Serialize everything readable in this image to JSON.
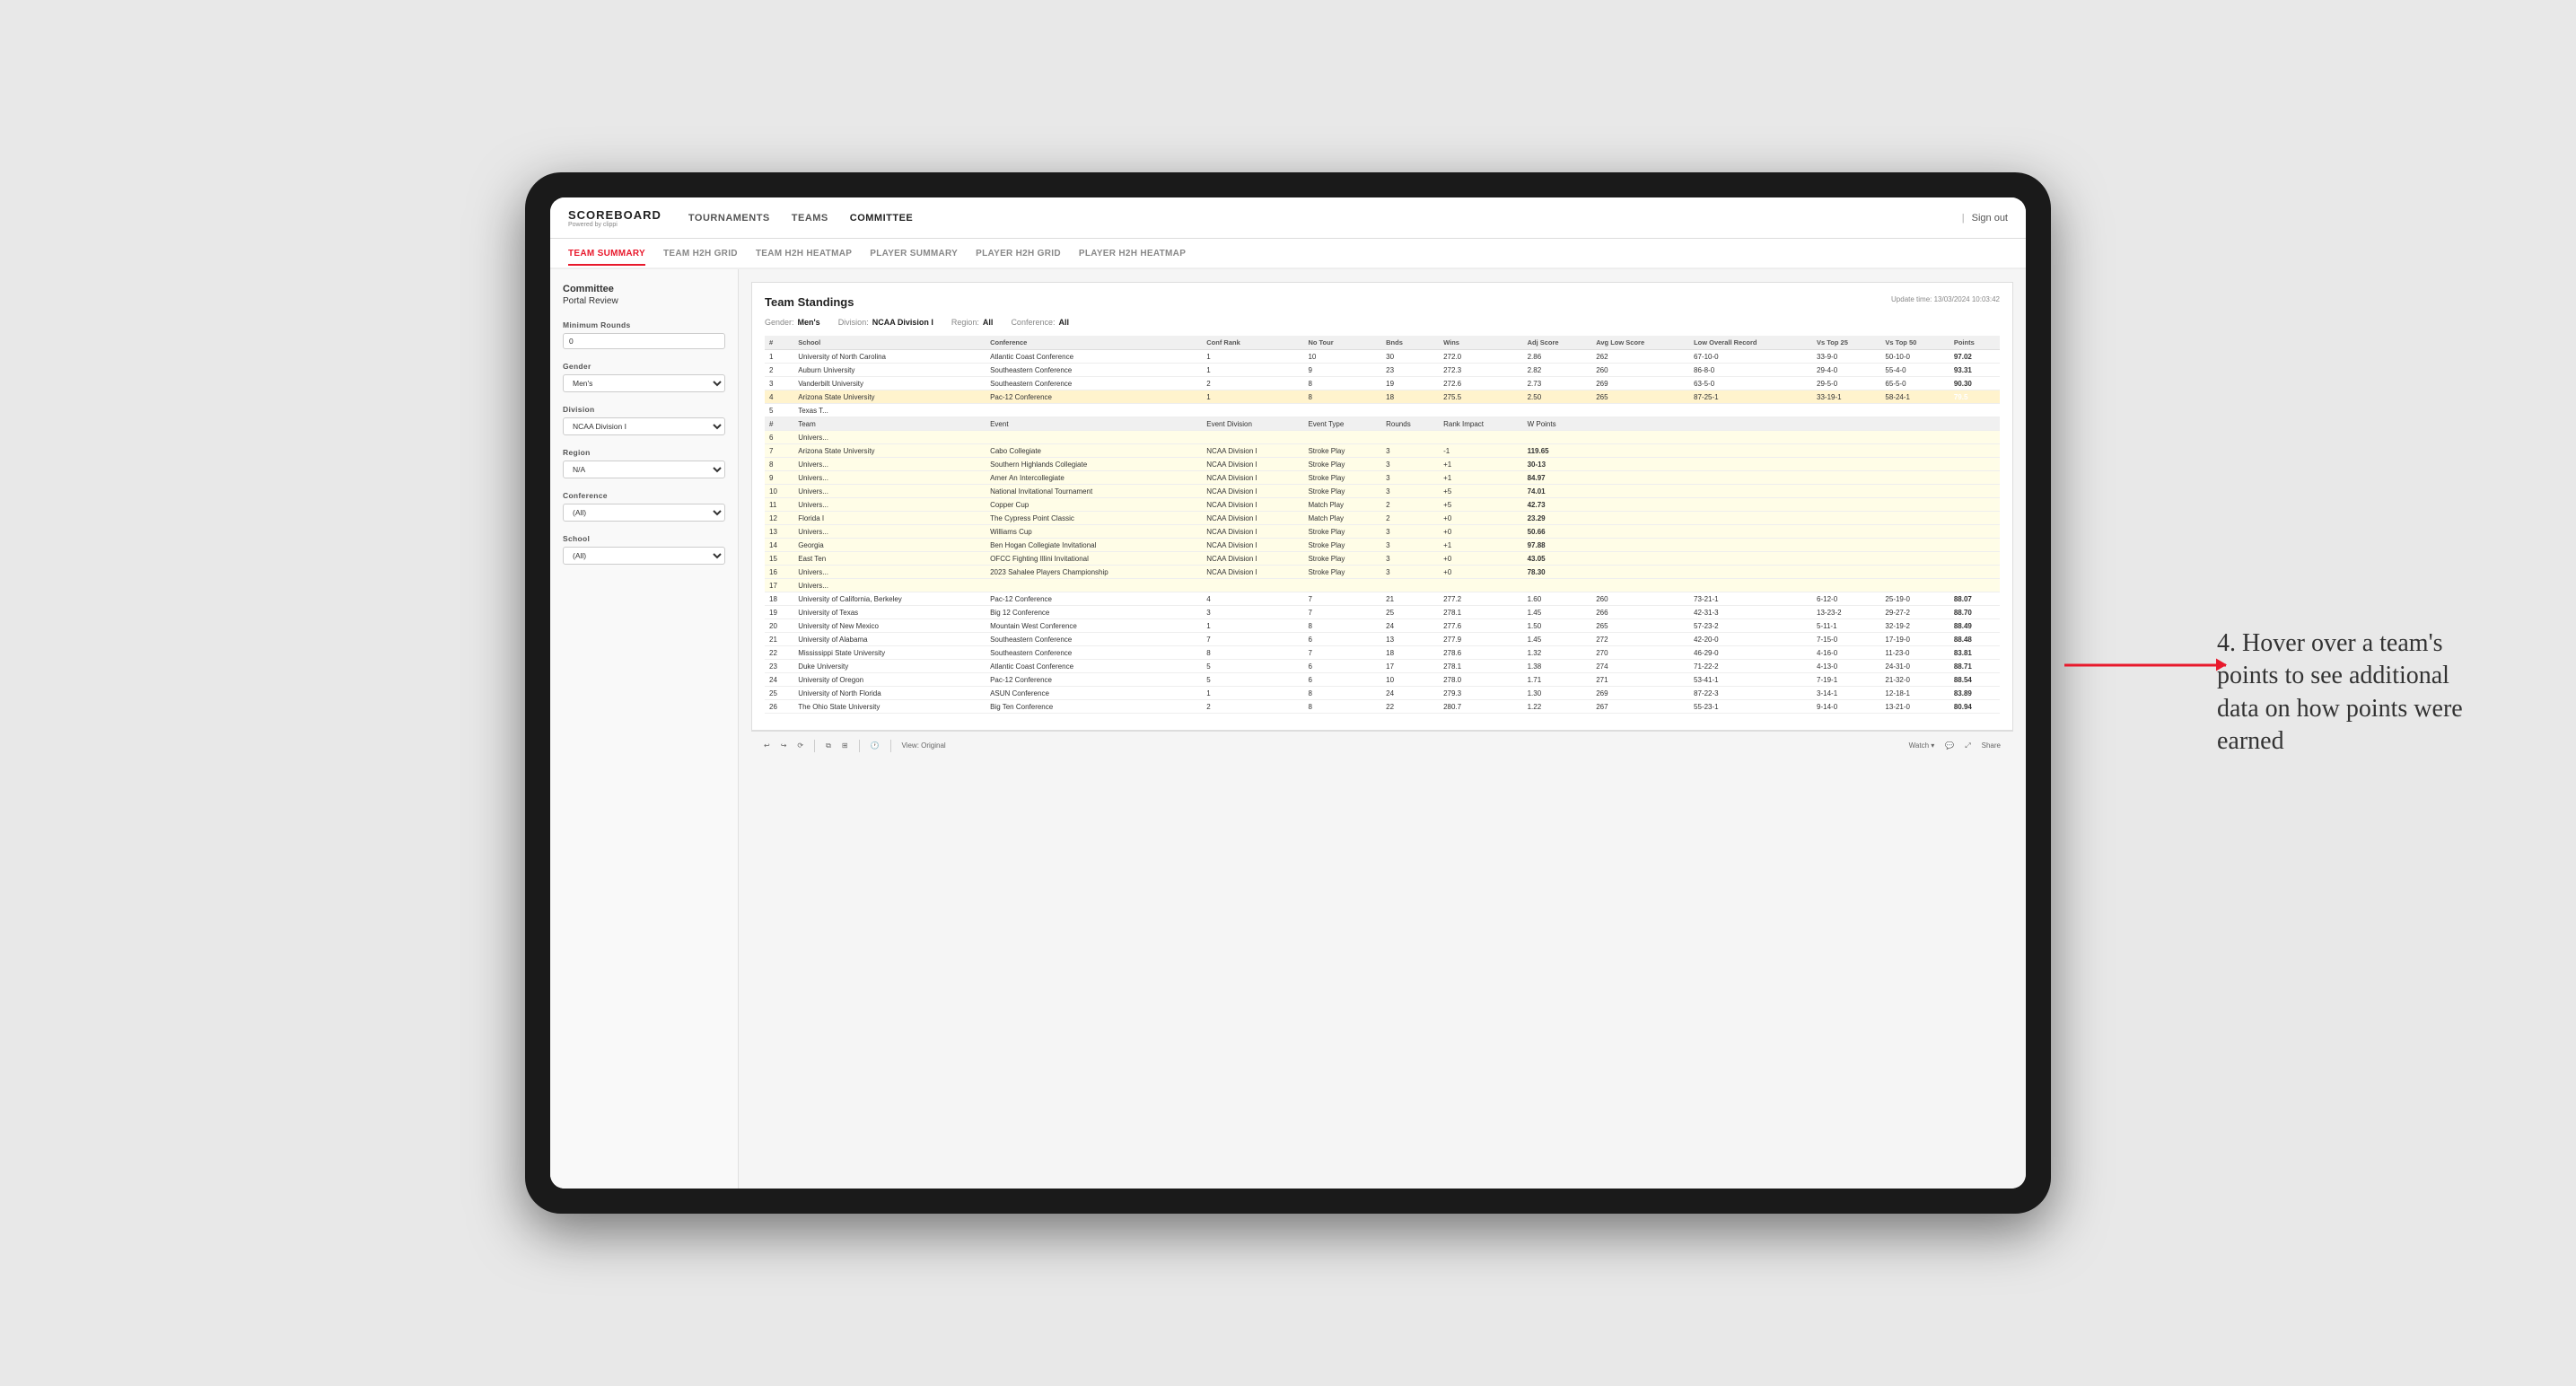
{
  "app": {
    "logo": "SCOREBOARD",
    "logo_sub": "Powered by clippi",
    "sign_out": "Sign out"
  },
  "main_nav": {
    "items": [
      {
        "label": "TOURNAMENTS",
        "active": false
      },
      {
        "label": "TEAMS",
        "active": false
      },
      {
        "label": "COMMITTEE",
        "active": true
      }
    ]
  },
  "sub_nav": {
    "items": [
      {
        "label": "TEAM SUMMARY",
        "active": true
      },
      {
        "label": "TEAM H2H GRID",
        "active": false
      },
      {
        "label": "TEAM H2H HEATMAP",
        "active": false
      },
      {
        "label": "PLAYER SUMMARY",
        "active": false
      },
      {
        "label": "PLAYER H2H GRID",
        "active": false
      },
      {
        "label": "PLAYER H2H HEATMAP",
        "active": false
      }
    ]
  },
  "sidebar": {
    "title": "Committee",
    "subtitle": "Portal Review",
    "sections": [
      {
        "label": "Minimum Rounds",
        "type": "input",
        "value": "0"
      },
      {
        "label": "Gender",
        "type": "select",
        "value": "Men's"
      },
      {
        "label": "Division",
        "type": "select",
        "value": "NCAA Division I"
      },
      {
        "label": "Region",
        "type": "select",
        "value": "N/A"
      },
      {
        "label": "Conference",
        "type": "select",
        "value": "(All)"
      },
      {
        "label": "School",
        "type": "select",
        "value": "(All)"
      }
    ]
  },
  "report": {
    "title": "Team Standings",
    "update_time": "Update time: 13/03/2024 10:03:42",
    "filters": {
      "gender_label": "Gender:",
      "gender_value": "Men's",
      "division_label": "Division:",
      "division_value": "NCAA Division I",
      "region_label": "Region:",
      "region_value": "All",
      "conference_label": "Conference:",
      "conference_value": "All"
    },
    "columns": [
      "#",
      "School",
      "Conference",
      "Conf Rank",
      "No Tour",
      "Bnds",
      "Wins",
      "Adj Score",
      "Avg Low Score",
      "Low Overall Record",
      "Vs Top 25",
      "Vs Top 50",
      "Points"
    ],
    "rows": [
      {
        "rank": 1,
        "school": "University of North Carolina",
        "conference": "Atlantic Coast Conference",
        "conf_rank": 1,
        "tours": 10,
        "bnds": 30,
        "wins": 272.0,
        "adj": 2.86,
        "avg": 262,
        "low": "67-10-0",
        "overall": "33-9-0",
        "top25": "50-10-0",
        "points": "97.02",
        "highlighted": false
      },
      {
        "rank": 2,
        "school": "Auburn University",
        "conference": "Southeastern Conference",
        "conf_rank": 1,
        "tours": 9,
        "bnds": 23,
        "wins": 272.3,
        "adj": 2.82,
        "avg": 260,
        "low": "86-8-0",
        "overall": "29-4-0",
        "top25": "55-4-0",
        "points": "93.31",
        "highlighted": false
      },
      {
        "rank": 3,
        "school": "Vanderbilt University",
        "conference": "Southeastern Conference",
        "conf_rank": 2,
        "tours": 8,
        "bnds": 19,
        "wins": 272.6,
        "adj": 2.73,
        "avg": 269,
        "low": "63-5-0",
        "overall": "29-5-0",
        "top25": "65-5-0",
        "points": "90.30",
        "highlighted": false
      },
      {
        "rank": 4,
        "school": "Arizona State University",
        "conference": "Pac-12 Conference",
        "conf_rank": 1,
        "tours": 8,
        "bnds": 18,
        "wins": 275.5,
        "adj": 2.5,
        "avg": 265,
        "low": "87-25-1",
        "overall": "33-19-1",
        "top25": "58-24-1",
        "points": "79.5",
        "highlighted": true
      },
      {
        "rank": 5,
        "school": "Texas T...",
        "conference": "",
        "conf_rank": "",
        "tours": "",
        "bnds": "",
        "wins": "",
        "adj": "",
        "avg": "",
        "low": "",
        "overall": "",
        "top25": "",
        "points": "",
        "highlighted": false
      }
    ],
    "expanded_rows": [
      {
        "num": 6,
        "team": "Univers...",
        "event": "",
        "division": "",
        "type": "",
        "rounds": "",
        "rank_impact": "",
        "w_points": ""
      },
      {
        "num": 7,
        "team": "Arizona State University",
        "event": "Cabo Collegiate",
        "division": "NCAA Division I",
        "type": "Stroke Play",
        "rounds": 3,
        "rank_impact": "-1",
        "w_points": "119.65"
      },
      {
        "num": 8,
        "team": "Univers...",
        "event": "Southern Highlands Collegiate",
        "division": "NCAA Division I",
        "type": "Stroke Play",
        "rounds": 3,
        "rank_impact": "+1",
        "w_points": "30-13"
      },
      {
        "num": 9,
        "team": "Univers...",
        "event": "Amer An Intercollegiate",
        "division": "NCAA Division I",
        "type": "Stroke Play",
        "rounds": 3,
        "rank_impact": "+1",
        "w_points": "84.97"
      },
      {
        "num": 10,
        "team": "Univers...",
        "event": "National Invitational Tournament",
        "division": "NCAA Division I",
        "type": "Stroke Play",
        "rounds": 3,
        "rank_impact": "+5",
        "w_points": "74.01"
      },
      {
        "num": 11,
        "team": "Univers...",
        "event": "Copper Cup",
        "division": "NCAA Division I",
        "type": "Match Play",
        "rounds": 2,
        "rank_impact": "+5",
        "w_points": "42.73"
      },
      {
        "num": 12,
        "team": "Florida I",
        "event": "The Cypress Point Classic",
        "division": "NCAA Division I",
        "type": "Match Play",
        "rounds": 2,
        "rank_impact": "+0",
        "w_points": "23.29"
      },
      {
        "num": 13,
        "team": "Univers...",
        "event": "Williams Cup",
        "division": "NCAA Division I",
        "type": "Stroke Play",
        "rounds": 3,
        "rank_impact": "+0",
        "w_points": "50.66"
      },
      {
        "num": 14,
        "team": "Georgia",
        "event": "Ben Hogan Collegiate Invitational",
        "division": "NCAA Division I",
        "type": "Stroke Play",
        "rounds": 3,
        "rank_impact": "+1",
        "w_points": "97.88"
      },
      {
        "num": 15,
        "team": "East Ten",
        "event": "OFCC Fighting Illini Invitational",
        "division": "NCAA Division I",
        "type": "Stroke Play",
        "rounds": 3,
        "rank_impact": "+0",
        "w_points": "43.05"
      },
      {
        "num": 16,
        "team": "Univers...",
        "event": "2023 Sahalee Players Championship",
        "division": "NCAA Division I",
        "type": "Stroke Play",
        "rounds": 3,
        "rank_impact": "+0",
        "w_points": "78.30"
      },
      {
        "num": 17,
        "team": "Univers...",
        "event": "",
        "division": "",
        "type": "",
        "rounds": "",
        "rank_impact": "",
        "w_points": ""
      }
    ],
    "lower_rows": [
      {
        "rank": 18,
        "school": "University of California, Berkeley",
        "conference": "Pac-12 Conference",
        "conf_rank": 4,
        "tours": 7,
        "bnds": 21,
        "wins": 277.2,
        "adj": 1.6,
        "avg": 260,
        "low": "73-21-1",
        "overall": "6-12-0",
        "top25": "25-19-0",
        "points": "88.07"
      },
      {
        "rank": 19,
        "school": "University of Texas",
        "conference": "Big 12 Conference",
        "conf_rank": 3,
        "tours": 7,
        "bnds": 25,
        "wins": 278.1,
        "adj": 1.45,
        "avg": 266,
        "low": "42-31-3",
        "overall": "13-23-2",
        "top25": "29-27-2",
        "points": "88.70"
      },
      {
        "rank": 20,
        "school": "University of New Mexico",
        "conference": "Mountain West Conference",
        "conf_rank": 1,
        "tours": 8,
        "bnds": 24,
        "wins": 277.6,
        "adj": 1.5,
        "avg": 265,
        "low": "57-23-2",
        "overall": "5-11-1",
        "top25": "32-19-2",
        "points": "88.49"
      },
      {
        "rank": 21,
        "school": "University of Alabama",
        "conference": "Southeastern Conference",
        "conf_rank": 7,
        "tours": 6,
        "bnds": 13,
        "wins": 277.9,
        "adj": 1.45,
        "avg": 272,
        "low": "42-20-0",
        "overall": "7-15-0",
        "top25": "17-19-0",
        "points": "88.48"
      },
      {
        "rank": 22,
        "school": "Mississippi State University",
        "conference": "Southeastern Conference",
        "conf_rank": 8,
        "tours": 7,
        "bnds": 18,
        "wins": 278.6,
        "adj": 1.32,
        "avg": 270,
        "low": "46-29-0",
        "overall": "4-16-0",
        "top25": "11-23-0",
        "points": "83.81"
      },
      {
        "rank": 23,
        "school": "Duke University",
        "conference": "Atlantic Coast Conference",
        "conf_rank": 5,
        "tours": 6,
        "bnds": 17,
        "wins": 278.1,
        "adj": 1.38,
        "avg": 274,
        "low": "71-22-2",
        "overall": "4-13-0",
        "top25": "24-31-0",
        "points": "88.71"
      },
      {
        "rank": 24,
        "school": "University of Oregon",
        "conference": "Pac-12 Conference",
        "conf_rank": 5,
        "tours": 6,
        "bnds": 10,
        "wins": 278.0,
        "adj": 1.71,
        "avg": 271,
        "low": "53-41-1",
        "overall": "7-19-1",
        "top25": "21-32-0",
        "points": "88.54"
      },
      {
        "rank": 25,
        "school": "University of North Florida",
        "conference": "ASUN Conference",
        "conf_rank": 1,
        "tours": 8,
        "bnds": 24,
        "wins": 279.3,
        "adj": 1.3,
        "avg": 269,
        "low": "87-22-3",
        "overall": "3-14-1",
        "top25": "12-18-1",
        "points": "83.89"
      },
      {
        "rank": 26,
        "school": "The Ohio State University",
        "conference": "Big Ten Conference",
        "conf_rank": 2,
        "tours": 8,
        "bnds": 22,
        "wins": 280.7,
        "adj": 1.22,
        "avg": 267,
        "low": "55-23-1",
        "overall": "9-14-0",
        "top25": "13-21-0",
        "points": "80.94"
      }
    ]
  },
  "bottom_toolbar": {
    "undo": "↩",
    "redo": "↪",
    "refresh": "⟳",
    "view_original": "View: Original",
    "watch": "Watch ▾",
    "share": "Share"
  },
  "annotation": {
    "text": "4. Hover over a team's points to see additional data on how points were earned"
  }
}
